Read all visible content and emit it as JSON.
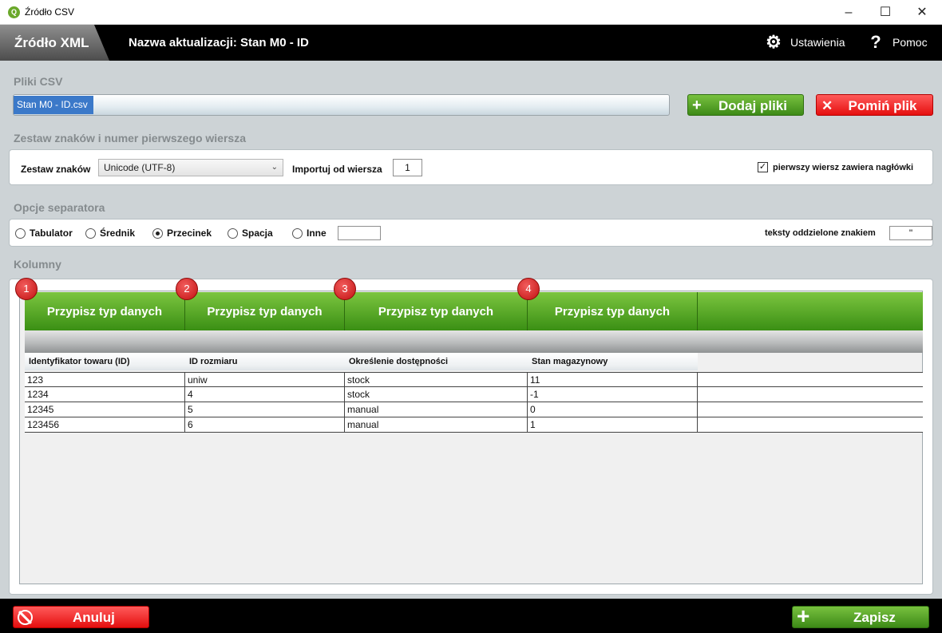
{
  "window": {
    "title": "Źródło CSV",
    "app_icon_text": "Q"
  },
  "header": {
    "tab_label": "Źródło XML",
    "update_name": "Nazwa aktualizacji: Stan M0 - ID",
    "settings_label": "Ustawienia",
    "help_label": "Pomoc"
  },
  "csv_files": {
    "section_label": "Pliki CSV",
    "file_name": "Stan M0 - ID.csv",
    "add_button": "Dodaj pliki",
    "skip_button": "Pomiń plik"
  },
  "charset": {
    "section_label": "Zestaw znaków i numer pierwszego wiersza",
    "charset_label": "Zestaw znaków",
    "charset_value": "Unicode (UTF-8)",
    "import_from_label": "Importuj od wiersza",
    "import_from_value": "1",
    "header_checkbox_label": "pierwszy wiersz zawiera nagłówki",
    "header_checked": true
  },
  "separator": {
    "section_label": "Opcje separatora",
    "options": [
      {
        "label": "Tabulator",
        "selected": false
      },
      {
        "label": "Średnik",
        "selected": false
      },
      {
        "label": "Przecinek",
        "selected": true
      },
      {
        "label": "Spacja",
        "selected": false
      },
      {
        "label": "Inne",
        "selected": false
      }
    ],
    "other_value": "",
    "text_qualifier_label": "teksty oddzielone znakiem",
    "text_qualifier_value": "\""
  },
  "columns": {
    "section_label": "Kolumny",
    "assign_label": "Przypisz typ danych",
    "badges": [
      "1",
      "2",
      "3",
      "4"
    ],
    "headers": [
      "Identyfikator towaru (ID)",
      "ID rozmiaru",
      "Określenie dostępności",
      "Stan magazynowy"
    ],
    "rows": [
      [
        "123",
        "uniw",
        "stock",
        "11"
      ],
      [
        "1234",
        "4",
        "stock",
        "-1"
      ],
      [
        "12345",
        "5",
        "manual",
        "0"
      ],
      [
        "123456",
        "6",
        "manual",
        "1"
      ]
    ]
  },
  "footer": {
    "cancel_button": "Anuluj",
    "save_button": "Zapisz"
  },
  "colors": {
    "green": "#4a9e1f",
    "red": "#f01e1e",
    "header_bg": "#000000",
    "file_chip": "#3b79c9"
  }
}
